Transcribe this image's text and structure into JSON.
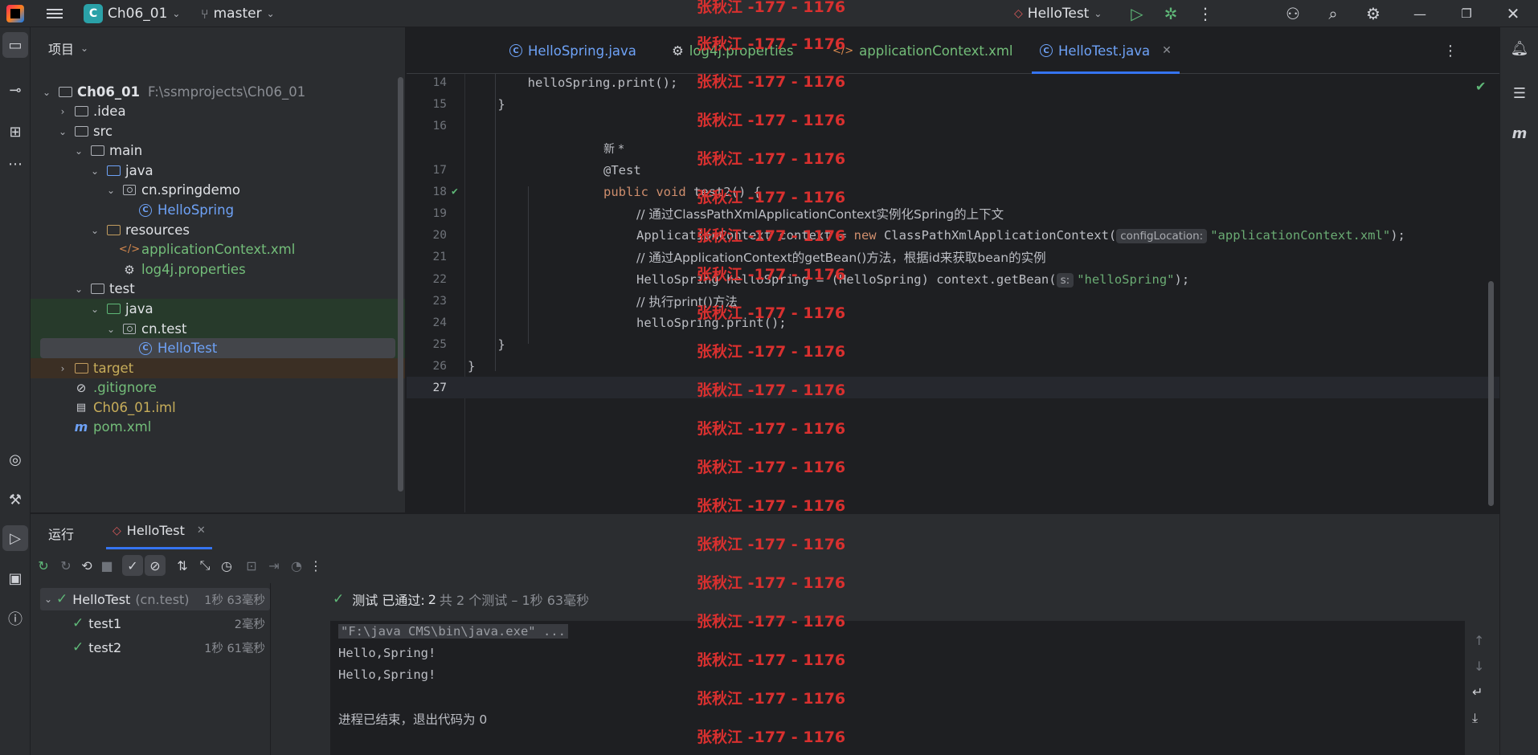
{
  "titlebar": {
    "project_badge": "C",
    "project_name": "Ch06_01",
    "branch": "master",
    "run_config": "HelloTest"
  },
  "project_panel": {
    "header": "项目",
    "root_name": "Ch06_01",
    "root_path": "F:\\ssmprojects\\Ch06_01",
    "items": [
      {
        "label": ".idea"
      },
      {
        "label": "src"
      },
      {
        "label": "main"
      },
      {
        "label": "java"
      },
      {
        "label": "cn.springdemo"
      },
      {
        "label": "HelloSpring"
      },
      {
        "label": "resources"
      },
      {
        "label": "applicationContext.xml"
      },
      {
        "label": "log4j.properties"
      },
      {
        "label": "test"
      },
      {
        "label": "java"
      },
      {
        "label": "cn.test"
      },
      {
        "label": "HelloTest"
      },
      {
        "label": "target"
      },
      {
        "label": ".gitignore"
      },
      {
        "label": "Ch06_01.iml"
      },
      {
        "label": "pom.xml"
      }
    ]
  },
  "tabs": [
    {
      "label": "HelloSpring.java"
    },
    {
      "label": "log4j.properties"
    },
    {
      "label": "applicationContext.xml"
    },
    {
      "label": "HelloTest.java"
    }
  ],
  "editor": {
    "lines": [
      {
        "n": "14",
        "code": "        helloSpring.print();"
      },
      {
        "n": "15",
        "code": "    }"
      },
      {
        "n": "16",
        "code": ""
      },
      {
        "meta": "新 *"
      },
      {
        "n": "17",
        "annotation": "@Test"
      },
      {
        "n": "18",
        "kw": "public void ",
        "code": "test2() {"
      },
      {
        "n": "19",
        "comment": "// 通过ClassPathXmlApplicationContext实例化Spring的上下文"
      },
      {
        "n": "20",
        "pre": "ApplicationContext context = ",
        "kw": "new ",
        "code": "ClassPathXmlApplicationContext(",
        "hint": "configLocation:",
        "str": "\"applicationContext.xml\"",
        "post": ");"
      },
      {
        "n": "21",
        "comment": "// 通过ApplicationContext的getBean()方法，根据id来获取bean的实例"
      },
      {
        "n": "22",
        "pre": "HelloSpring helloSpring = (HelloSpring) context.getBean(",
        "hint": "s:",
        "str": "\"helloSpring\"",
        "post": ");"
      },
      {
        "n": "23",
        "comment": "// 执行print()方法"
      },
      {
        "n": "24",
        "code": "helloSpring.print();"
      },
      {
        "n": "25",
        "code": "    }"
      },
      {
        "n": "26",
        "code": "}"
      },
      {
        "n": "27",
        "code": ""
      }
    ]
  },
  "run_panel": {
    "title": "运行",
    "tab_label": "HelloTest",
    "summary_prefix": "测试 已通过:",
    "summary_count": "2",
    "summary_suffix": "共 2 个测试 – 1秒 63毫秒",
    "tests": [
      {
        "name": "HelloTest",
        "pkg": "(cn.test)",
        "duration": "1秒 63毫秒"
      },
      {
        "name": "test1",
        "duration": "2毫秒"
      },
      {
        "name": "test2",
        "duration": "1秒 61毫秒"
      }
    ],
    "console": [
      "\"F:\\java CMS\\bin\\java.exe\" ...",
      "Hello,Spring!",
      "Hello,Spring!",
      "",
      "进程已结束，退出代码为 0"
    ]
  },
  "watermark": "张秋江 -177 - 1176"
}
